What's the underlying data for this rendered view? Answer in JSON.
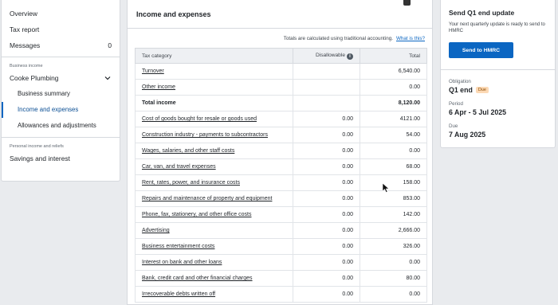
{
  "sidebar": {
    "items": [
      {
        "label": "Overview",
        "count": ""
      },
      {
        "label": "Tax report",
        "count": ""
      },
      {
        "label": "Messages",
        "count": "0"
      }
    ],
    "business_section_label": "Business income",
    "business_name": "Cooke Plumbing",
    "business_sub": [
      {
        "label": "Business summary"
      },
      {
        "label": "Income and expenses"
      },
      {
        "label": "Allowances and adjustments"
      }
    ],
    "personal_section_label": "Personal income and reliefs",
    "personal_items": [
      {
        "label": "Savings and interest"
      }
    ]
  },
  "main": {
    "title": "Income and expenses",
    "notice_text": "Totals are calculated using traditional accounting.",
    "notice_link": "What is this?",
    "table": {
      "headers": {
        "category": "Tax category",
        "disallowable": "Disallowable",
        "total": "Total"
      },
      "rows": [
        {
          "category": "Turnover",
          "disallowable": "",
          "total": "6,540.00",
          "link": true
        },
        {
          "category": "Other income",
          "disallowable": "",
          "total": "0.00",
          "link": true
        },
        {
          "category": "Total income",
          "disallowable": "",
          "total": "8,120.00",
          "link": false
        },
        {
          "category": "Cost of goods bought for resale or goods used",
          "disallowable": "0.00",
          "total": "4121.00",
          "link": true
        },
        {
          "category": "Construction industry - payments to subcontractors",
          "disallowable": "0.00",
          "total": "54.00",
          "link": true
        },
        {
          "category": "Wages, salaries, and other staff costs",
          "disallowable": "0.00",
          "total": "0.00",
          "link": true
        },
        {
          "category": "Car, van, and travel expenses",
          "disallowable": "0.00",
          "total": "68.00",
          "link": true
        },
        {
          "category": "Rent, rates, power, and insurance costs",
          "disallowable": "0.00",
          "total": "158.00",
          "link": true
        },
        {
          "category": "Repairs and maintenance of property and equipment",
          "disallowable": "0.00",
          "total": "853.00",
          "link": true
        },
        {
          "category": "Phone, fax, stationery, and other office costs",
          "disallowable": "0.00",
          "total": "142.00",
          "link": true
        },
        {
          "category": "Advertising",
          "disallowable": "0.00",
          "total": "2,666.00",
          "link": true
        },
        {
          "category": "Business entertainment costs",
          "disallowable": "0.00",
          "total": "326.00",
          "link": true
        },
        {
          "category": "Interest on bank and other loans",
          "disallowable": "0.00",
          "total": "0.00",
          "link": true
        },
        {
          "category": "Bank, credit card and other financial charges",
          "disallowable": "0.00",
          "total": "80.00",
          "link": true
        },
        {
          "category": "Irrecoverable debts written off",
          "disallowable": "0.00",
          "total": "0.00",
          "link": true
        }
      ]
    }
  },
  "right": {
    "title": "Send Q1 end update",
    "description": "Your next quarterly update is ready to send to HMRC",
    "button": "Send to HMRC",
    "obligation_label": "Obligation",
    "obligation_value": "Q1 end",
    "obligation_badge": "Due",
    "period_label": "Period",
    "period_value": "6 Apr - 5 Jul 2025",
    "due_label": "Due",
    "due_value": "7 Aug 2025"
  },
  "colors": {
    "accent": "#0b66c2",
    "badge_bg": "#fcd9b5"
  },
  "icons": [
    "chevron-down-icon",
    "info-icon",
    "mouse-cursor-icon"
  ]
}
